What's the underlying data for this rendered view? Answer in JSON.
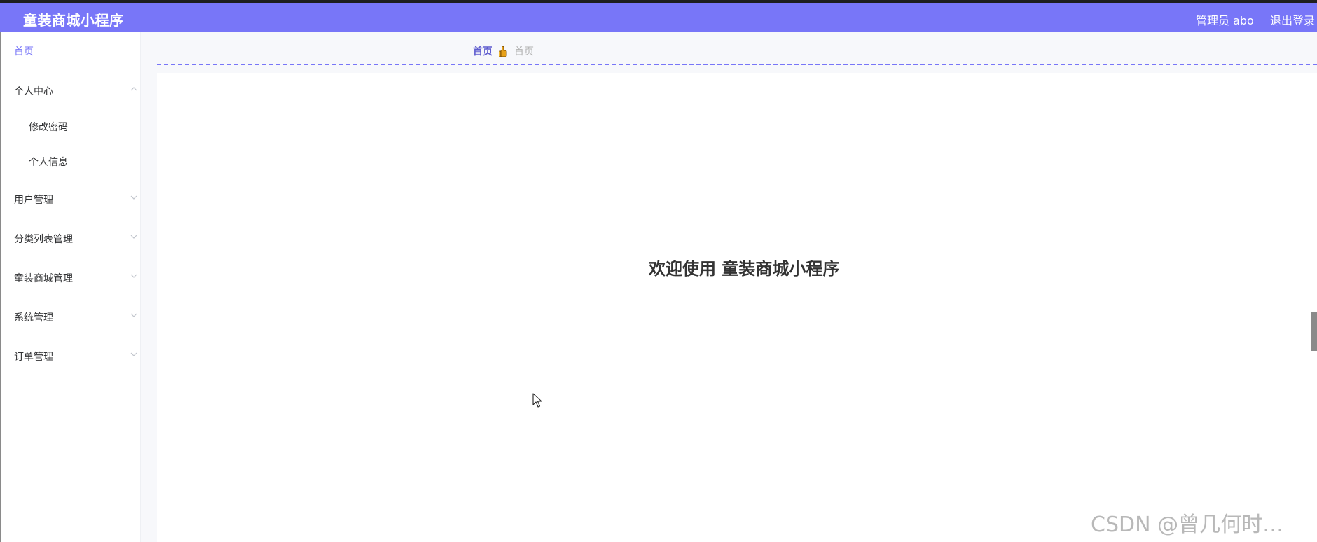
{
  "app": {
    "title": "童装商城小程序",
    "user_label": "管理员 abo",
    "logout_label": "退出登录"
  },
  "sidebar": {
    "items": [
      {
        "label": "首页",
        "active": true
      },
      {
        "label": "个人中心",
        "expanded": true
      },
      {
        "label": "修改密码",
        "sub": true
      },
      {
        "label": "个人信息",
        "sub": true
      },
      {
        "label": "用户管理"
      },
      {
        "label": "分类列表管理"
      },
      {
        "label": "童装商城管理"
      },
      {
        "label": "系统管理"
      },
      {
        "label": "订单管理"
      }
    ]
  },
  "breadcrumb": {
    "home": "首页",
    "current": "首页",
    "separator_icon": "thumbs-up-icon"
  },
  "main": {
    "welcome": "欢迎使用 童装商城小程序"
  },
  "watermark": "CSDN @曾几何时…",
  "colors": {
    "header": "#7876f8",
    "accent": "#5f5dcf",
    "dash": "#7876f8"
  }
}
